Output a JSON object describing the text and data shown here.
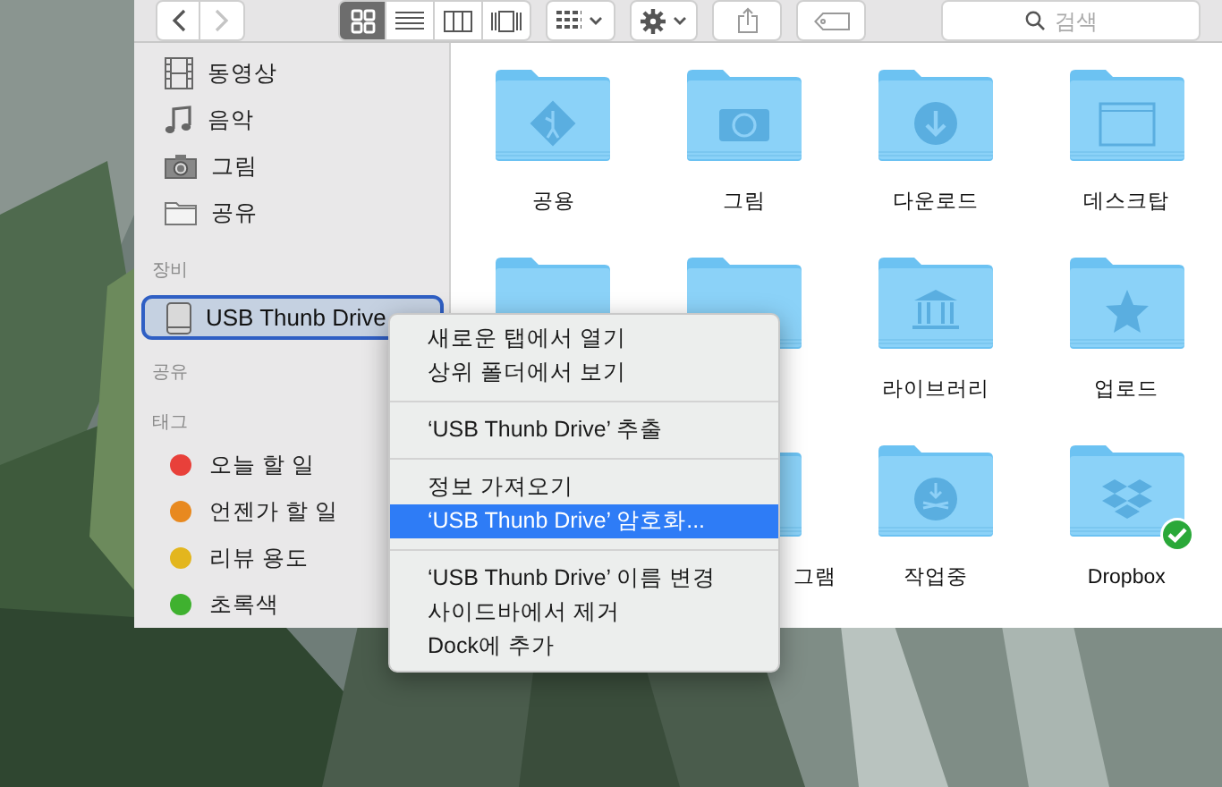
{
  "toolbar": {
    "back": {
      "disabled": false
    },
    "forward": {
      "disabled": true
    },
    "views": [
      {
        "selected": true
      },
      {
        "selected": false
      },
      {
        "selected": false
      },
      {
        "selected": false
      }
    ],
    "search": {
      "placeholder": "검색"
    }
  },
  "sidebar": {
    "favorites": [
      {
        "label": "동영상"
      },
      {
        "label": "음악"
      },
      {
        "label": "그림"
      },
      {
        "label": "공유"
      }
    ],
    "devices_heading": "장비",
    "devices": [
      {
        "label": "USB Thunb Drive",
        "selected": true
      }
    ],
    "shared_heading": "공유",
    "tags_heading": "태그",
    "tags": [
      {
        "label": "오늘 할 일",
        "color": "#e8403a"
      },
      {
        "label": "언젠가 할 일",
        "color": "#e8891f"
      },
      {
        "label": "리뷰 용도",
        "color": "#e3b61e"
      },
      {
        "label": "초록색",
        "color": "#3fb12f"
      }
    ]
  },
  "folders": [
    {
      "kind": "folder",
      "label": "공용"
    },
    {
      "kind": "folder",
      "label": "그림"
    },
    {
      "kind": "folder",
      "label": "다운로드"
    },
    {
      "kind": "folder",
      "label": "데스크탑"
    },
    {
      "kind": "folder"
    },
    {
      "kind": "folder"
    },
    {
      "kind": "folder",
      "label": "라이브러리"
    },
    {
      "kind": "folder",
      "label": "업로드"
    },
    {
      "kind": "hidden"
    },
    {
      "kind": "folder",
      "label": "그램",
      "clipped": true
    },
    {
      "kind": "folder",
      "label": "작업중"
    },
    {
      "kind": "folder",
      "label": "Dropbox",
      "synced": true
    }
  ],
  "context_menu": [
    [
      {
        "label": "새로운 탭에서 열기",
        "selected": false
      },
      {
        "label": "상위 폴더에서 보기",
        "selected": false
      }
    ],
    [
      {
        "label": "‘USB Thunb Drive’ 추출",
        "selected": false
      }
    ],
    [
      {
        "label": "정보 가져오기",
        "selected": false
      },
      {
        "label": "‘USB Thunb Drive’ 암호화...",
        "selected": true
      }
    ],
    [
      {
        "label": "‘USB Thunb Drive’ 이름 변경",
        "selected": false
      },
      {
        "label": "사이드바에서 제거",
        "selected": false
      },
      {
        "label": "Dock에 추가",
        "selected": false
      }
    ]
  ]
}
